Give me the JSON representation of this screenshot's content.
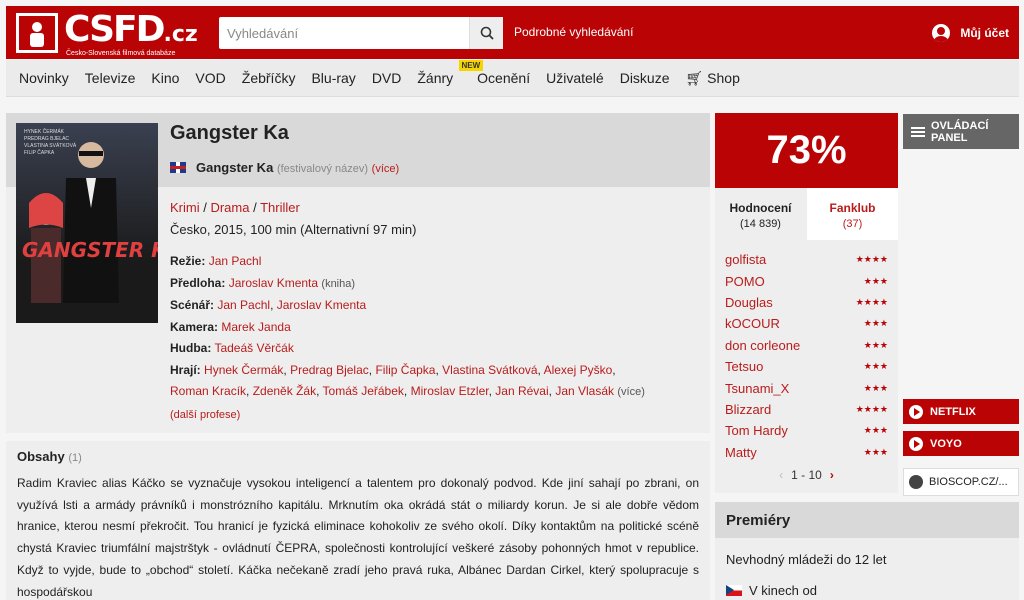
{
  "header": {
    "logo_text": "CSFD",
    "logo_tld": ".cz",
    "logo_sub": "Česko-Slovenská filmová databáze",
    "search_placeholder": "Vyhledávání",
    "advanced_search": "Podrobné vyhledávání",
    "account": "Můj účet"
  },
  "nav": {
    "items": [
      "Novinky",
      "Televize",
      "Kino",
      "VOD",
      "Žebříčky",
      "Blu-ray",
      "DVD",
      "Žánry",
      "Ocenění",
      "Uživatelé",
      "Diskuze",
      "Shop"
    ],
    "badge_new": "NEW"
  },
  "film": {
    "title": "Gangster Ka",
    "alt_title": "Gangster Ka",
    "alt_title_note": "(festivalový název)",
    "alt_more": "(více)",
    "genres": [
      "Krimi",
      "Drama",
      "Thriller"
    ],
    "origin": "Česko, 2015, 100 min (Alternativní 97 min)",
    "poster_title": "GANGSTER KA",
    "crew": {
      "rezie_label": "Režie:",
      "rezie": [
        "Jan Pachl"
      ],
      "predloha_label": "Předloha:",
      "predloha": "Jaroslav Kmenta",
      "predloha_note": "(kniha)",
      "scenar_label": "Scénář:",
      "scenar": [
        "Jan Pachl",
        "Jaroslav Kmenta"
      ],
      "kamera_label": "Kamera:",
      "kamera": [
        "Marek Janda"
      ],
      "hudba_label": "Hudba:",
      "hudba": [
        "Tadeáš Věrčák"
      ],
      "hraji_label": "Hrají:",
      "hraji": [
        "Hynek Čermák",
        "Predrag Bjelac",
        "Filip Čapka",
        "Vlastina Svátková",
        "Alexej Pyško",
        "Roman Kracík",
        "Zdeněk Žák",
        "Tomáš Jeřábek",
        "Miroslav Etzler",
        "Jan Révai",
        "Jan Vlasák"
      ],
      "more": "(více)",
      "more_professions": "(další profese)"
    }
  },
  "obsahy": {
    "heading": "Obsahy",
    "count": "(1)",
    "text": "Radim Kraviec alias Káčko se vyznačuje vysokou inteligencí a talentem pro dokonalý podvod. Kde jiní sahají po zbrani, on využívá lsti a armády právníků i monstrózního kapitálu. Mrknutím oka okrádá stát o miliardy korun. Je si ale dobře vědom hranice, kterou nesmí překročit. Tou hranicí je fyzická eliminace kohokoliv ze svého okolí. Díky kontaktům na politické scéně chystá Kraviec triumfální majstrštyk - ovládnutí ČEPRA, společnosti kontrolující veškeré zásoby pohonných hmot v republice. Když to vyjde, bude to „obchod“ století. Káčka nečekaně zradí jeho pravá ruka, Albánec Dardan Cirkel, který spolupracuje s hospodářskou"
  },
  "rating": {
    "score": "73%",
    "tab_hodnoceni": "Hodnocení",
    "tab_hodnoceni_count": "(14 839)",
    "tab_fanklub": "Fanklub",
    "tab_fanklub_count": "(37)",
    "users": [
      {
        "name": "golfista",
        "stars": 4
      },
      {
        "name": "POMO",
        "stars": 3
      },
      {
        "name": "Douglas",
        "stars": 4
      },
      {
        "name": "kOCOUR",
        "stars": 3
      },
      {
        "name": "don corleone",
        "stars": 3
      },
      {
        "name": "Tetsuo",
        "stars": 3
      },
      {
        "name": "Tsunami_X",
        "stars": 3
      },
      {
        "name": "Blizzard",
        "stars": 4
      },
      {
        "name": "Tom Hardy",
        "stars": 3
      },
      {
        "name": "Matty",
        "stars": 3
      }
    ],
    "pager": "1 - 10"
  },
  "sidebar": {
    "panel_label": "OVLÁDACÍ PANEL",
    "netflix": "NETFLIX",
    "voyo": "VOYO",
    "bioscop": "BIOSCOP.CZ/..."
  },
  "premiery": {
    "heading": "Premiéry",
    "age": "Nevhodný mládeži do 12 let",
    "cinema": "V kinech od"
  },
  "colors": {
    "brand": "#ba0305",
    "link": "#b91c1c"
  }
}
